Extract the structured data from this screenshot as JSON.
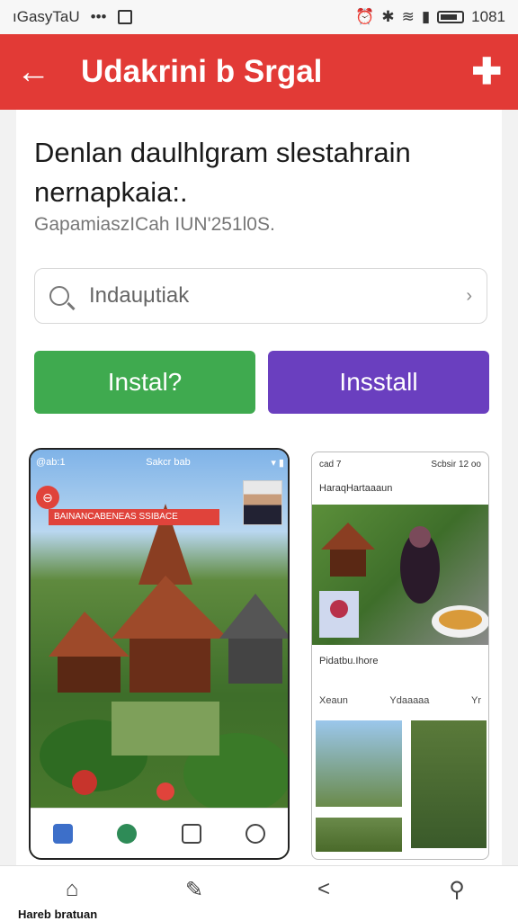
{
  "status_bar": {
    "left_text": "ıGasyTaU",
    "dots": "•••",
    "right_time": "1081"
  },
  "app_bar": {
    "back_icon": "←",
    "title": "Udakrini b Srgal",
    "add_icon": "✚"
  },
  "content": {
    "headline": "Denlan daulhlgram slestahrain nernapkaia:.",
    "subline": "GapamiaszICah IUN'251l0S.",
    "search": {
      "value": "Indauμtiak",
      "chevron": "›"
    },
    "buttons": {
      "green_label": "Instal?",
      "purple_label": "Insstall"
    }
  },
  "phone_left": {
    "status_left": "@ab:1",
    "status_mid": "Sakcr bab",
    "banner": "BAINANCABENEAS SSIBACE",
    "redcirc": "⊖"
  },
  "phone_right": {
    "status_left": "cad 7",
    "status_mid": "Scbsir 12 oo",
    "header": "HaraqHartaaaun",
    "section_label": "Pidatbu.Ihore",
    "tab1": "Xeaun",
    "tab2": "Ydaaaaa",
    "tab3": "Yr"
  },
  "bottom_nav": {
    "label": "Hareb bratuan",
    "home_icon": "⌂",
    "edit_icon": "✎",
    "share_icon": "<",
    "search_icon": "⚲"
  },
  "colors": {
    "accent": "#e23a36",
    "green": "#3faa4f",
    "purple": "#6a3fbf"
  }
}
